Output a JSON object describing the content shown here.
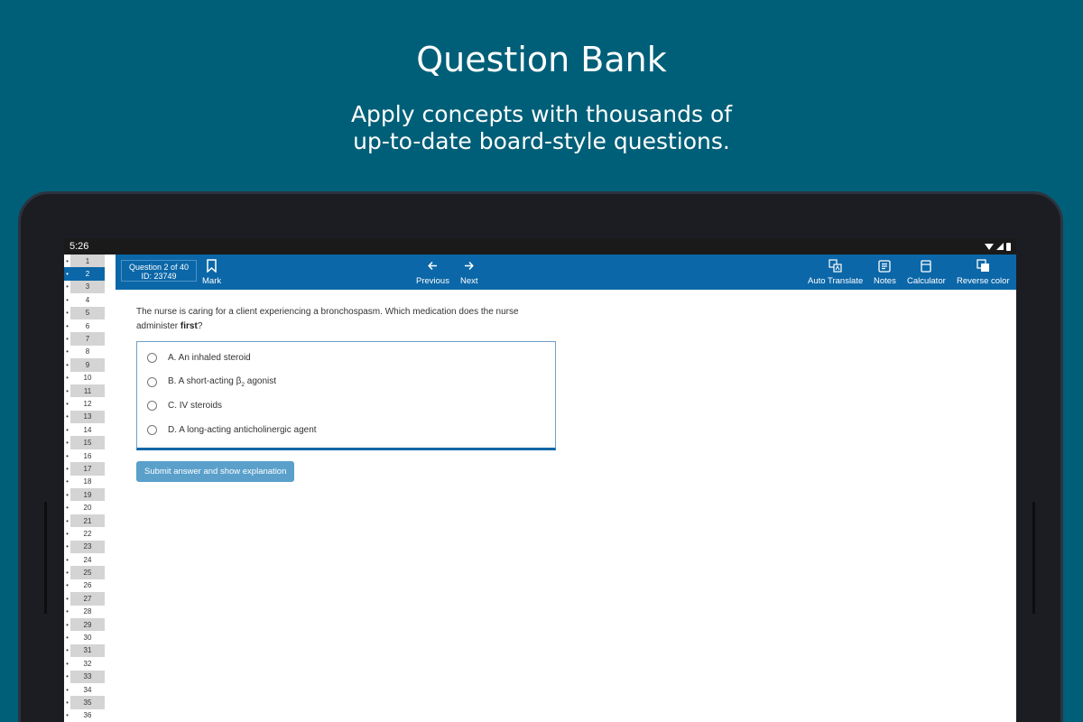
{
  "promo": {
    "title": "Question Bank",
    "subtitle_line1": "Apply concepts with thousands of",
    "subtitle_line2": "up-to-date board-style questions."
  },
  "status_bar": {
    "time": "5:26",
    "icons": [
      "wifi-icon",
      "signal-icon",
      "battery-icon"
    ]
  },
  "sidebar": {
    "active_index": 1,
    "items": [
      "1",
      "2",
      "3",
      "4",
      "5",
      "6",
      "7",
      "8",
      "9",
      "10",
      "11",
      "12",
      "13",
      "14",
      "15",
      "16",
      "17",
      "18",
      "19",
      "20",
      "21",
      "22",
      "23",
      "24",
      "25",
      "26",
      "27",
      "28",
      "29",
      "30",
      "31",
      "32",
      "33",
      "34",
      "35",
      "36"
    ]
  },
  "toolbar": {
    "question_label": "Question 2 of 40",
    "id_label": "ID: 23749",
    "mark_label": "Mark",
    "previous_label": "Previous",
    "next_label": "Next",
    "auto_translate_label": "Auto Translate",
    "notes_label": "Notes",
    "calculator_label": "Calculator",
    "reverse_color_label": "Reverse color"
  },
  "question": {
    "text_before": "The nurse is caring for a client experiencing a bronchospasm. Which medication does the nurse administer ",
    "text_bold": "first",
    "text_after": "?",
    "choices": [
      {
        "label": "A. An inhaled steroid"
      },
      {
        "label": "B. A short-acting β",
        "sub": "2",
        "after": " agonist"
      },
      {
        "label": "C. IV steroids"
      },
      {
        "label": "D.  A long-acting anticholinergic agent"
      }
    ],
    "submit_label": "Submit answer and show explanation"
  },
  "colors": {
    "background": "#005f78",
    "toolbar": "#0b67a8",
    "submit": "#5aa0cb"
  }
}
